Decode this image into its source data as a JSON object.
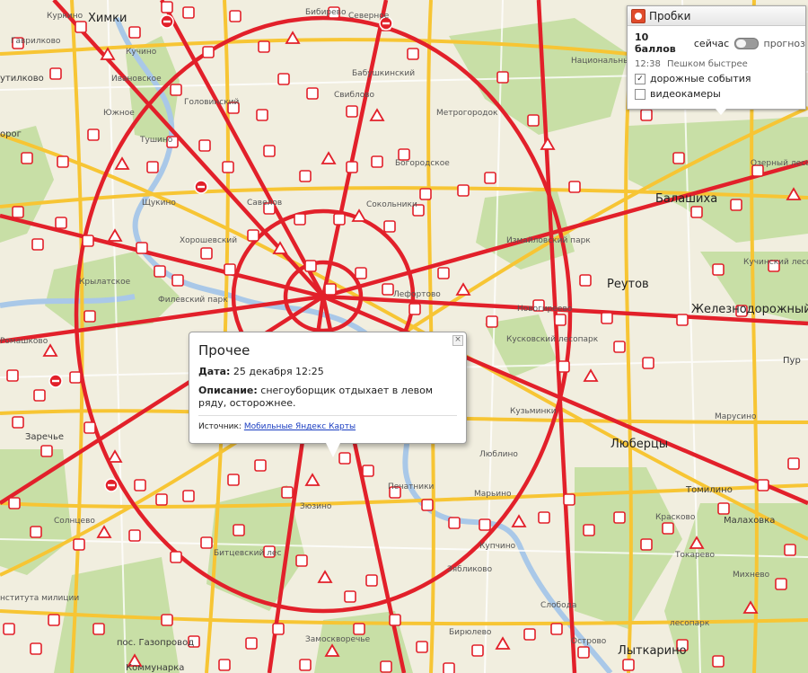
{
  "traffic_panel": {
    "title": "Пробки",
    "score": "10 баллов",
    "now_label": "сейчас",
    "forecast_label": "прогноз",
    "time": "12:38",
    "walk_hint": "Пешком быстрее",
    "layer_road_events": "дорожные события",
    "layer_road_events_checked": true,
    "layer_cameras": "видеокамеры",
    "layer_cameras_checked": false,
    "icon": "traffic-light-icon"
  },
  "balloon": {
    "title": "Прочее",
    "date_label": "Дата:",
    "date_value": "25 декабря 12:25",
    "description_label": "Описание:",
    "description_value": "снегоуборщик отдыхает в левом ряду, осторожнее.",
    "source_label": "Источник:",
    "source_link": "Мобильные Яндекс Карты",
    "close_icon": "close-icon"
  },
  "map": {
    "places": [
      {
        "key": "himki",
        "name": "Химки",
        "size": "big"
      },
      {
        "key": "kurkino",
        "name": "Куркино",
        "size": "sm"
      },
      {
        "key": "gavrilkovo",
        "name": "Гаврилково",
        "size": "sm"
      },
      {
        "key": "putilkovo",
        "name": "утилково",
        "size": "md"
      },
      {
        "key": "gorod",
        "name": "орог",
        "size": "md"
      },
      {
        "key": "ivanovskoe",
        "name": "Ивановское",
        "size": "sm"
      },
      {
        "key": "kuchino",
        "name": "Кучино",
        "size": "sm"
      },
      {
        "key": "yuzhnoe",
        "name": "Южное",
        "size": "sm"
      },
      {
        "key": "tushino",
        "name": "Тушино",
        "size": "sm"
      },
      {
        "key": "shukino",
        "name": "Щукино",
        "size": "sm"
      },
      {
        "key": "golovinsky",
        "name": "Головинский",
        "size": "sm"
      },
      {
        "key": "savelovo",
        "name": "Савелов",
        "size": "sm"
      },
      {
        "key": "khoroshevsky",
        "name": "Хорошевский",
        "size": "sm"
      },
      {
        "key": "krylatskoe",
        "name": "Крылатское",
        "size": "sm"
      },
      {
        "key": "filevsky",
        "name": "Филевский парк",
        "size": "sm"
      },
      {
        "key": "romashkovo",
        "name": "Ромашково",
        "size": "sm"
      },
      {
        "key": "zarechye",
        "name": "Заречье",
        "size": "md"
      },
      {
        "key": "solntsevo",
        "name": "Солнцево",
        "size": "sm"
      },
      {
        "key": "institut",
        "name": "нститута милиции",
        "size": "sm"
      },
      {
        "key": "gazoprovod",
        "name": "пос. Газопровод",
        "size": "md"
      },
      {
        "key": "kommunarka",
        "name": "Коммунарка",
        "size": "md"
      },
      {
        "key": "bibirevo",
        "name": "Бибирево",
        "size": "sm"
      },
      {
        "key": "severnoe",
        "name": "Северное",
        "size": "sm"
      },
      {
        "key": "babushkinsky",
        "name": "Бабушкинский",
        "size": "sm"
      },
      {
        "key": "sviblovo",
        "name": "Свиблово",
        "size": "sm"
      },
      {
        "key": "metrogorodok",
        "name": "Метрогородок",
        "size": "sm"
      },
      {
        "key": "bogorodskoe",
        "name": "Богородское",
        "size": "sm"
      },
      {
        "key": "sokolniki",
        "name": "Сокольники",
        "size": "sm"
      },
      {
        "key": "izmailovsky",
        "name": "Измайловский парк",
        "size": "sm"
      },
      {
        "key": "losiny",
        "name": "Национальный парк Лосиный остров",
        "size": "sm"
      },
      {
        "key": "balashikha",
        "name": "Балашиха",
        "size": "big"
      },
      {
        "key": "reutov",
        "name": "Реутов",
        "size": "big"
      },
      {
        "key": "zheleznodorozhny",
        "name": "Железнодорожный",
        "size": "big"
      },
      {
        "key": "lefortovo",
        "name": "Лефортово",
        "size": "sm"
      },
      {
        "key": "kuskovsky",
        "name": "Кусковский лесопарк",
        "size": "sm"
      },
      {
        "key": "kuzminki",
        "name": "Кузьминки",
        "size": "sm"
      },
      {
        "key": "lyubertsy",
        "name": "Люберцы",
        "size": "big"
      },
      {
        "key": "tomilino",
        "name": "Томилино",
        "size": "md"
      },
      {
        "key": "malakhovka",
        "name": "Малаховка",
        "size": "md"
      },
      {
        "key": "kraskovo",
        "name": "Красково",
        "size": "sm"
      },
      {
        "key": "tokarevo",
        "name": "Токарево",
        "size": "sm"
      },
      {
        "key": "mikhnevo",
        "name": "Михнево",
        "size": "sm"
      },
      {
        "key": "lytkarino",
        "name": "Лыткарино",
        "size": "big"
      },
      {
        "key": "pechatniki",
        "name": "Печатники",
        "size": "sm"
      },
      {
        "key": "zyablikovo",
        "name": "Зябликово",
        "size": "sm"
      },
      {
        "key": "sloboda",
        "name": "Слобода",
        "size": "sm"
      },
      {
        "key": "bittsevsky",
        "name": "Битцевский лес",
        "size": "sm"
      },
      {
        "key": "zyuzino",
        "name": "Зюзино",
        "size": "sm"
      },
      {
        "key": "zamoskvorechye",
        "name": "Замоскворечье",
        "size": "sm"
      },
      {
        "key": "maryino",
        "name": "Марьино",
        "size": "sm"
      },
      {
        "key": "kupchino",
        "name": "Купчино",
        "size": "sm"
      },
      {
        "key": "lyubino",
        "name": "Люблино",
        "size": "sm"
      },
      {
        "key": "birulevo",
        "name": "Бирюлево",
        "size": "sm"
      },
      {
        "key": "novogireevo",
        "name": "Новогиреево",
        "size": "sm"
      },
      {
        "key": "maryino2",
        "name": "Марусино",
        "size": "sm"
      },
      {
        "key": "kuchinsky",
        "name": "Кучинский лесопарк",
        "size": "sm"
      },
      {
        "key": "ozerny",
        "name": "Озерный лесопарк",
        "size": "sm"
      },
      {
        "key": "ostrovo",
        "name": "Острово",
        "size": "sm"
      },
      {
        "key": "pur",
        "name": "Пур",
        "size": "md"
      },
      {
        "key": "lesoparksk",
        "name": "лесопарк",
        "size": "sm"
      }
    ]
  }
}
